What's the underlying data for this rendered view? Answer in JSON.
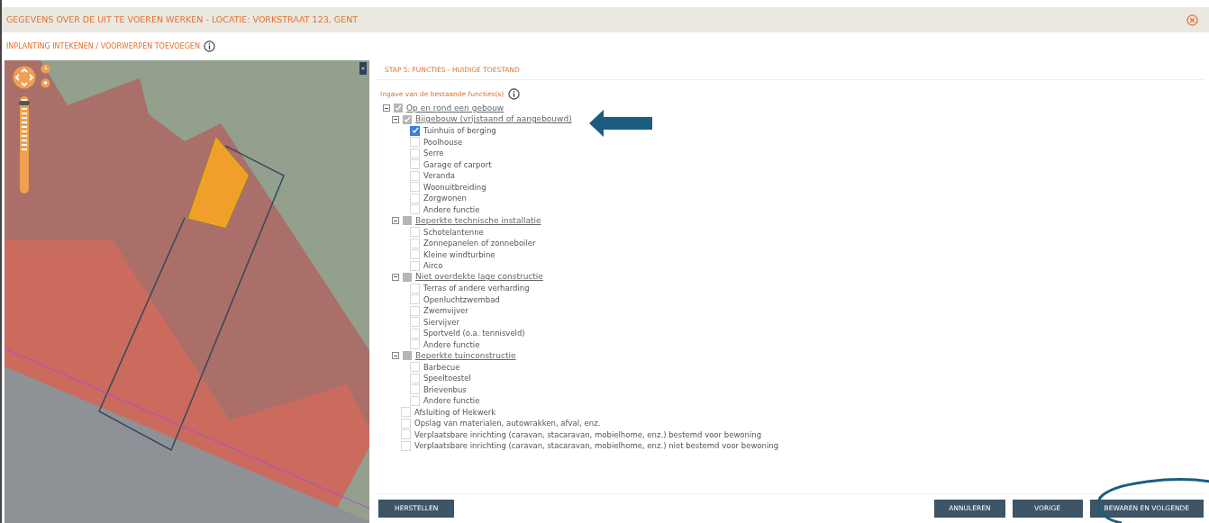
{
  "header": {
    "title": "GEGEVENS OVER DE UIT TE VOEREN WERKEN - LOCATIE: VORKSTRAAT 123, GENT"
  },
  "subheader": {
    "title": "INPLANTING INTEKENEN / VOORWERPEN TOEVOEGEN"
  },
  "map": {
    "collapse_button": "«",
    "zoom": {
      "level": 0.95
    }
  },
  "panel": {
    "step_title": "STAP 5: FUNCTIES - HUIDIGE TOESTAND",
    "prompt": "Ingave van de bestaande functies(s)",
    "tree": [
      {
        "label": "Op en rond een gebouw",
        "checked": true,
        "expanded": true,
        "children": [
          {
            "label": "Bijgebouw (vrijstaand of aangebouwd)",
            "checked": true,
            "expanded": true,
            "children": [
              {
                "label": "Tuinhuis of berging",
                "checked": true
              },
              {
                "label": "Poolhouse",
                "checked": false
              },
              {
                "label": "Serre",
                "checked": false
              },
              {
                "label": "Garage of carport",
                "checked": false
              },
              {
                "label": "Veranda",
                "checked": false
              },
              {
                "label": "Woonuitbreiding",
                "checked": false
              },
              {
                "label": "Zorgwonen",
                "checked": false
              },
              {
                "label": "Andere functie",
                "checked": false
              }
            ]
          },
          {
            "label": "Beperkte technische installatie",
            "checked": false,
            "expanded": true,
            "children": [
              {
                "label": "Schotelantenne",
                "checked": false
              },
              {
                "label": "Zonnepanelen of zonneboiler",
                "checked": false
              },
              {
                "label": "Kleine windturbine",
                "checked": false
              },
              {
                "label": "Airco",
                "checked": false
              }
            ]
          },
          {
            "label": "Niet overdekte lage constructie",
            "checked": false,
            "expanded": true,
            "children": [
              {
                "label": "Terras of andere verharding",
                "checked": false
              },
              {
                "label": "Openluchtzwembad",
                "checked": false
              },
              {
                "label": "Zwemvijver",
                "checked": false
              },
              {
                "label": "Siervijver",
                "checked": false
              },
              {
                "label": "Sportveld (o.a. tennisveld)",
                "checked": false
              },
              {
                "label": "Andere functie",
                "checked": false
              }
            ]
          },
          {
            "label": "Beperkte tuinconstructie",
            "checked": false,
            "expanded": true,
            "children": [
              {
                "label": "Barbecue",
                "checked": false
              },
              {
                "label": "Speeltoestel",
                "checked": false
              },
              {
                "label": "Brievenbus",
                "checked": false
              },
              {
                "label": "Andere functie",
                "checked": false
              }
            ]
          },
          {
            "label": "Afsluiting of Hekwerk",
            "checked": false
          },
          {
            "label": "Opslag van materialen, autowrakken, afval, enz.",
            "checked": false
          },
          {
            "label": "Verplaatsbare inrichting (caravan, stacaravan, mobielhome, enz.) bestemd voor bewoning",
            "checked": false
          },
          {
            "label": "Verplaatsbare inrichting (caravan, stacaravan, mobielhome, enz.) niet bestemd voor bewoning",
            "checked": false
          }
        ]
      }
    ]
  },
  "footer": {
    "left_buttons": [
      "HERSTELLEN"
    ],
    "right_buttons": [
      "ANNULEREN",
      "VORIGE",
      "BEWAREN EN VOLGENDE"
    ]
  }
}
